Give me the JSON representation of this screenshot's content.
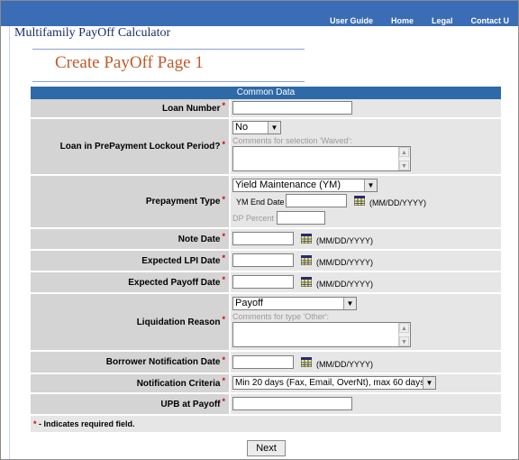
{
  "nav": [
    "User Guide",
    "Home",
    "Legal",
    "Contact U"
  ],
  "app_title": "Multifamily PayOff Calculator",
  "page_title": "Create PayOff Page 1",
  "section_header": "Common Data",
  "required_marker": "*",
  "fields": {
    "loan_number": {
      "label": "Loan Number",
      "value": ""
    },
    "lockout": {
      "label": "Loan in PrePayment Lockout Period?",
      "selected": "No",
      "comment_hint": "Comments for selection 'Waived':",
      "comment": ""
    },
    "prepayment_type": {
      "label": "Prepayment Type",
      "selected": "Yield Maintenance (YM)",
      "ym_end_date_label": "YM End Date",
      "ym_end_date": "",
      "date_format": "(MM/DD/YYYY)",
      "dp_percent_label": "DP Percent",
      "dp_percent": ""
    },
    "note_date": {
      "label": "Note Date",
      "value": "",
      "date_format": "(MM/DD/YYYY)"
    },
    "expected_lpi_date": {
      "label": "Expected LPI Date",
      "value": "",
      "date_format": "(MM/DD/YYYY)"
    },
    "expected_payoff_date": {
      "label": "Expected Payoff Date",
      "value": "",
      "date_format": "(MM/DD/YYYY)"
    },
    "liquidation_reason": {
      "label": "Liquidation Reason",
      "selected": "Payoff",
      "comment_hint": "Comments for type 'Other':",
      "comment": ""
    },
    "borrower_notification_date": {
      "label": "Borrower Notification Date",
      "value": "",
      "date_format": "(MM/DD/YYYY)"
    },
    "notification_criteria": {
      "label": "Notification Criteria",
      "selected": "Min 20 days (Fax, Email, OverNt), max 60 days"
    },
    "upb_at_payoff": {
      "label": "UPB at Payoff",
      "value": ""
    }
  },
  "footnote": " - Indicates required field.",
  "next_label": "Next",
  "colors": {
    "topbar": "#3a6db5",
    "header": "#2e6aa8",
    "title": "#c05a2a",
    "app_title": "#1a2d6e",
    "required": "#dd0000"
  }
}
